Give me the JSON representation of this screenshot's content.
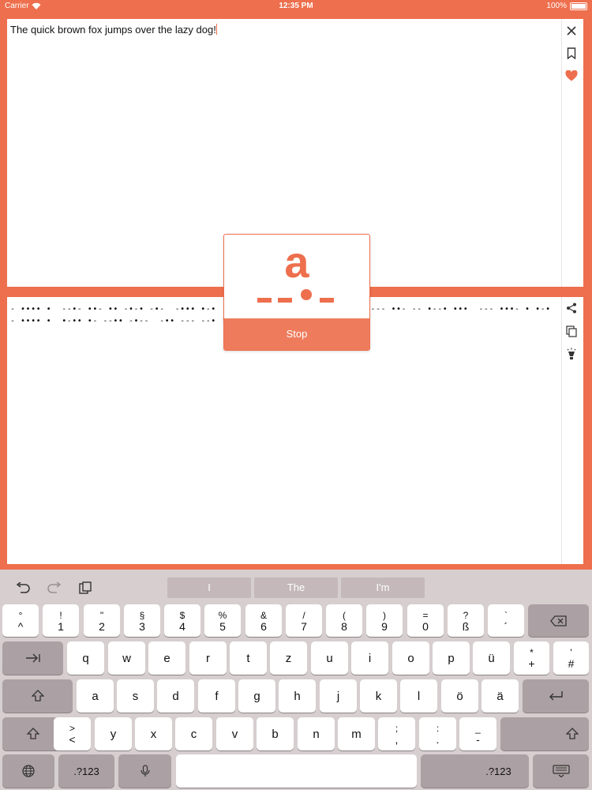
{
  "status": {
    "carrier": "Carrier",
    "time": "12:35 PM",
    "battery": "100%"
  },
  "input": {
    "text": "The quick brown fox jumps over the lazy dog"
  },
  "output": {
    "morse": "- •••• •  --•- ••- •• -•-• -•-  -••• •-•  --- •-- -•  ••-• --- -••-  •--- ••- -- •--• •••  --- •••- • •-•  - •••• •  •-•• •- --•• -•--  -•• --- --• !"
  },
  "overlay": {
    "letter": "a",
    "stop_label": "Stop"
  },
  "keyboard": {
    "suggestions": [
      "I",
      "The",
      "I'm"
    ],
    "row1": [
      {
        "top": "°",
        "bot": "^"
      },
      {
        "top": "!",
        "bot": "1"
      },
      {
        "top": "\"",
        "bot": "2"
      },
      {
        "top": "§",
        "bot": "3"
      },
      {
        "top": "$",
        "bot": "4"
      },
      {
        "top": "%",
        "bot": "5"
      },
      {
        "top": "&",
        "bot": "6"
      },
      {
        "top": "/",
        "bot": "7"
      },
      {
        "top": "(",
        "bot": "8"
      },
      {
        "top": ")",
        "bot": "9"
      },
      {
        "top": "=",
        "bot": "0"
      },
      {
        "top": "?",
        "bot": "ß"
      },
      {
        "top": "`",
        "bot": "´"
      }
    ],
    "row2": [
      "q",
      "w",
      "e",
      "r",
      "t",
      "z",
      "u",
      "i",
      "o",
      "p",
      "ü"
    ],
    "row2_extra": [
      {
        "top": "*",
        "bot": "+"
      },
      {
        "top": "'",
        "bot": "#"
      }
    ],
    "row3": [
      "a",
      "s",
      "d",
      "f",
      "g",
      "h",
      "j",
      "k",
      "l",
      "ö",
      "ä"
    ],
    "row4_first": {
      "top": ">",
      "bot": "<"
    },
    "row4": [
      "y",
      "x",
      "c",
      "v",
      "b",
      "n",
      "m"
    ],
    "row4_extra": [
      {
        "top": ";",
        "bot": ","
      },
      {
        "top": ":",
        "bot": "."
      },
      {
        "top": "_",
        "bot": "-"
      }
    ],
    "numbers_label": ".?123",
    "colors": {
      "accent": "#EE6F4D",
      "keyboard_bg": "#D6CECF",
      "key": "#FFFFFF",
      "key_dark": "#ABA0A3"
    }
  }
}
